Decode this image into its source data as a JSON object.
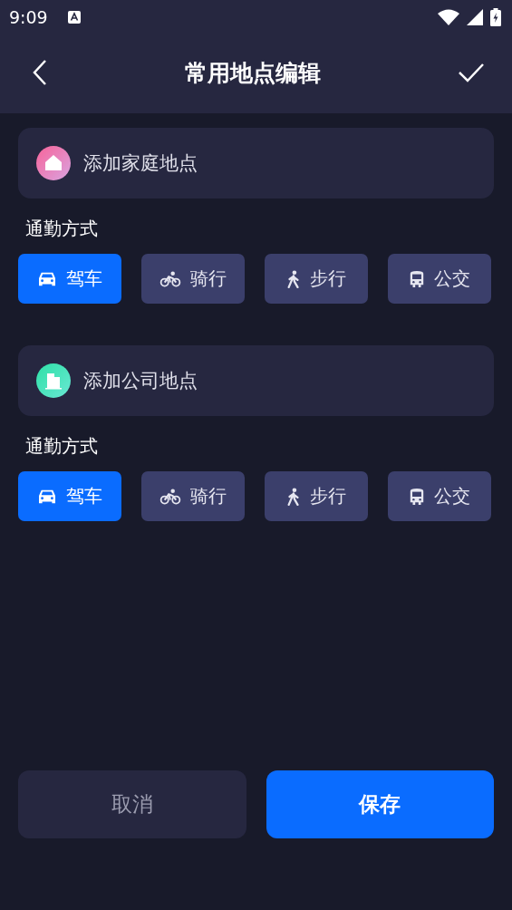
{
  "status_bar": {
    "time": "9:09"
  },
  "header": {
    "title": "常用地点编辑"
  },
  "places": [
    {
      "kind": "home",
      "label": "添加家庭地点",
      "mode_title": "通勤方式",
      "modes": [
        {
          "kind": "car",
          "label": "驾车",
          "selected": true
        },
        {
          "kind": "bike",
          "label": "骑行",
          "selected": false
        },
        {
          "kind": "walk",
          "label": "步行",
          "selected": false
        },
        {
          "kind": "bus",
          "label": "公交",
          "selected": false
        }
      ]
    },
    {
      "kind": "company",
      "label": "添加公司地点",
      "mode_title": "通勤方式",
      "modes": [
        {
          "kind": "car",
          "label": "驾车",
          "selected": true
        },
        {
          "kind": "bike",
          "label": "骑行",
          "selected": false
        },
        {
          "kind": "walk",
          "label": "步行",
          "selected": false
        },
        {
          "kind": "bus",
          "label": "公交",
          "selected": false
        }
      ]
    }
  ],
  "buttons": {
    "cancel": "取消",
    "save": "保存"
  }
}
